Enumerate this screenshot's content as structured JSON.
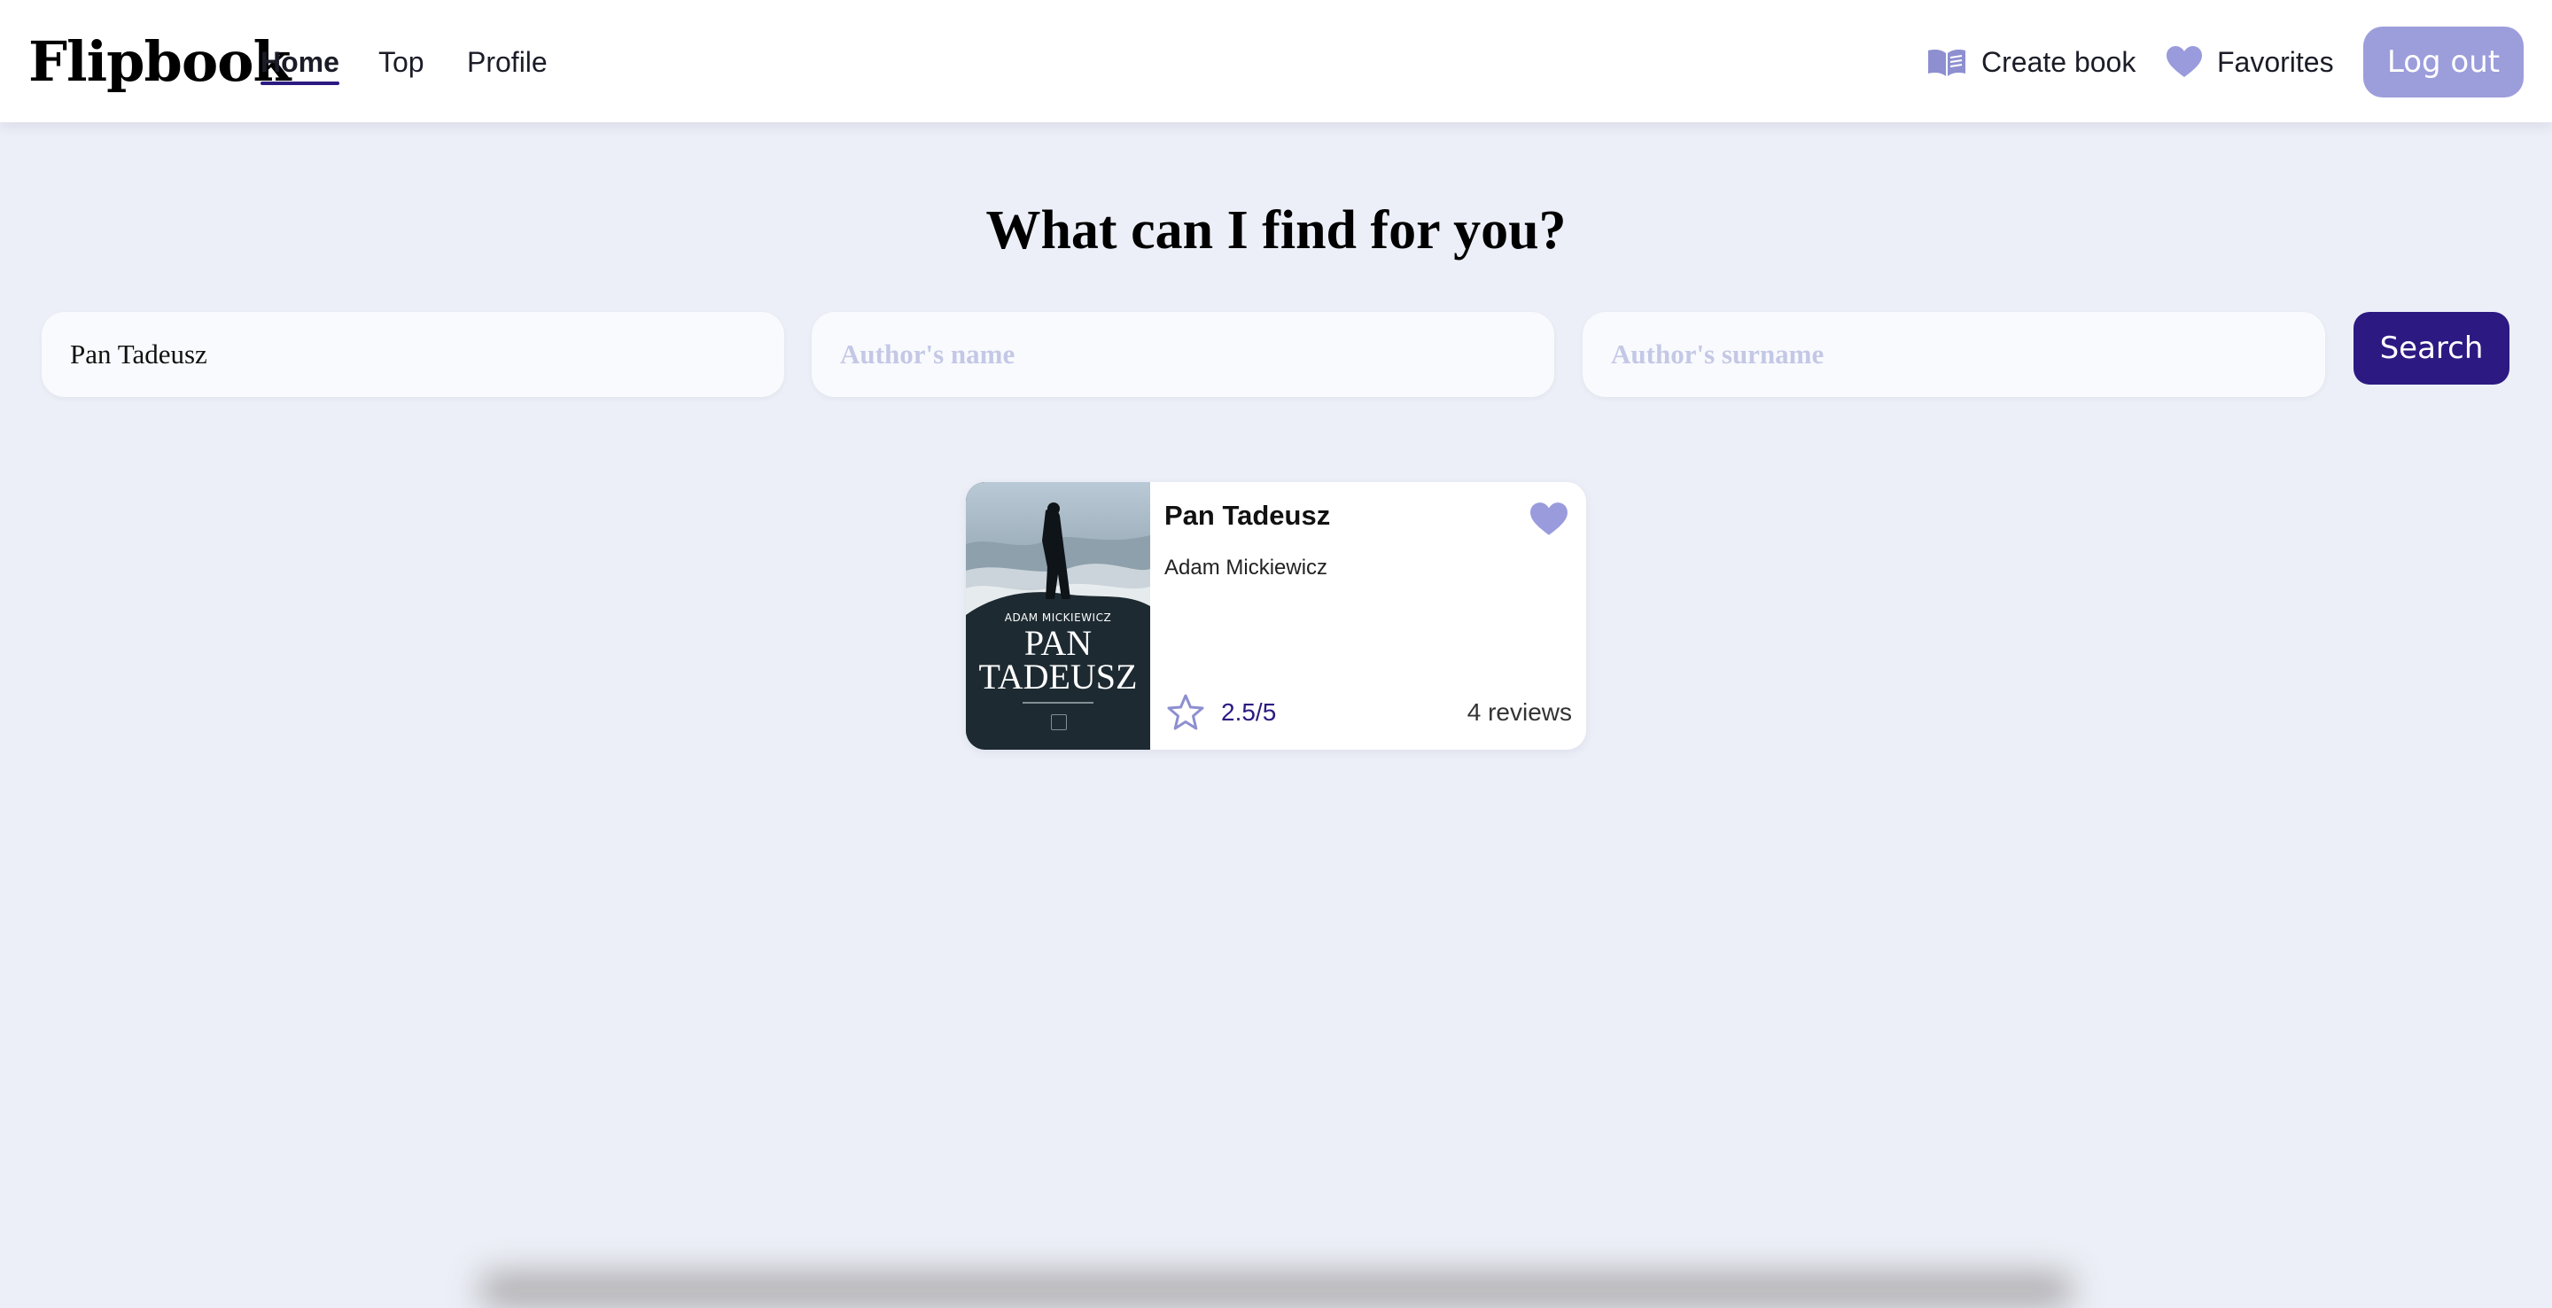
{
  "app": {
    "logo": "Flipbook"
  },
  "nav": {
    "home": "Home",
    "top": "Top",
    "profile": "Profile"
  },
  "header_actions": {
    "create_book": "Create book",
    "favorites": "Favorites",
    "logout": "Log out"
  },
  "main": {
    "headline": "What can I find for you?"
  },
  "search": {
    "title_value": "Pan Tadeusz",
    "author_name_placeholder": "Author's name",
    "author_surname_placeholder": "Author's surname",
    "button": "Search"
  },
  "results": [
    {
      "title": "Pan Tadeusz",
      "author": "Adam Mickiewicz",
      "rating": "2.5/5",
      "reviews": "4 reviews",
      "cover": {
        "author_text": "ADAM MICKIEWICZ",
        "title_line1": "PAN",
        "title_line2": "TADEUSZ"
      }
    }
  ],
  "colors": {
    "accent": "#2c1a82",
    "accent_light": "#9c9ddb",
    "page_background": "#eceff7"
  },
  "icons": {
    "create_book": "open-book-icon",
    "favorites": "heart-icon",
    "rating": "star-outline-icon",
    "card_favorite": "heart-icon"
  }
}
